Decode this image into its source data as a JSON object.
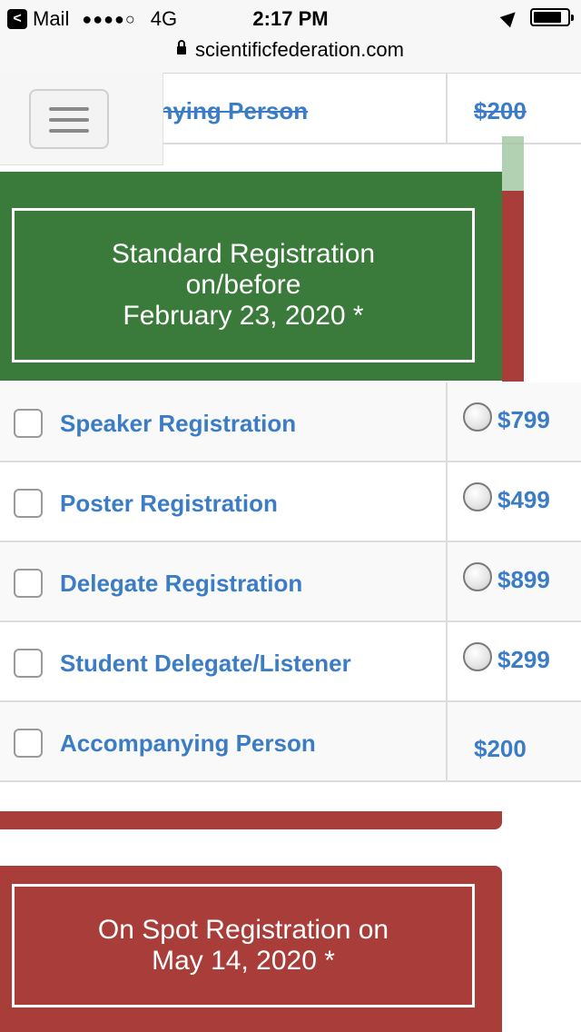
{
  "status_bar": {
    "back_app": "Mail",
    "signal": "●●●●○",
    "network": "4G",
    "time": "2:17 PM"
  },
  "url_bar": {
    "domain": "scientificfederation.com"
  },
  "top_row": {
    "label": "Accompanying Person",
    "price": "$200",
    "visible_label_fragment": "anying Person"
  },
  "standard": {
    "title_line1": "Standard Registration",
    "title_line2": "on/before",
    "title_line3": "February 23, 2020 *",
    "rows": [
      {
        "label": "Speaker Registration",
        "price": "$799",
        "has_radio": true
      },
      {
        "label": "Poster Registration",
        "price": "$499",
        "has_radio": true
      },
      {
        "label": "Delegate Registration",
        "price": "$899",
        "has_radio": true
      },
      {
        "label": "Student Delegate/Listener",
        "price": "$299",
        "has_radio": true
      },
      {
        "label": "Accompanying Person",
        "price": "$200",
        "has_radio": false
      }
    ]
  },
  "onspot": {
    "title_line1": "On Spot Registration on",
    "title_line2": "May 14, 2020 *"
  },
  "colors": {
    "green": "#3a7a3a",
    "red": "#a83d3a",
    "link_blue": "#3b7cc6"
  }
}
